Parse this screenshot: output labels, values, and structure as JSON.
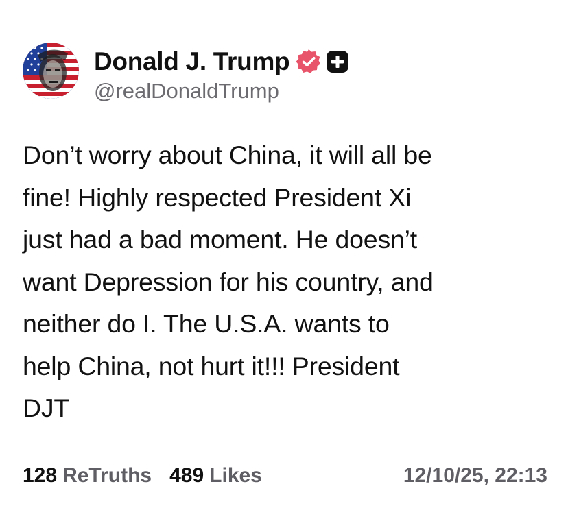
{
  "post": {
    "author": {
      "display_name": "Donald J. Trump",
      "handle": "@realDonaldTrump",
      "verified_badge_icon": "verified-badge-icon",
      "plus_badge_icon": "plus-badge-icon",
      "verified_color": "#e8556b"
    },
    "text": "Don’t worry about China, it will all be\nfine! Highly respected President Xi\njust had a bad moment. He doesn’t\nwant Depression for his country, and\nneither do I. The U.S.A. wants to\nhelp China, not hurt it!!! President\nDJT",
    "stats": {
      "retruths_count": "128",
      "retruths_label": "ReTruths",
      "likes_count": "489",
      "likes_label": "Likes"
    },
    "timestamp": "12/10/25, 22:13"
  }
}
